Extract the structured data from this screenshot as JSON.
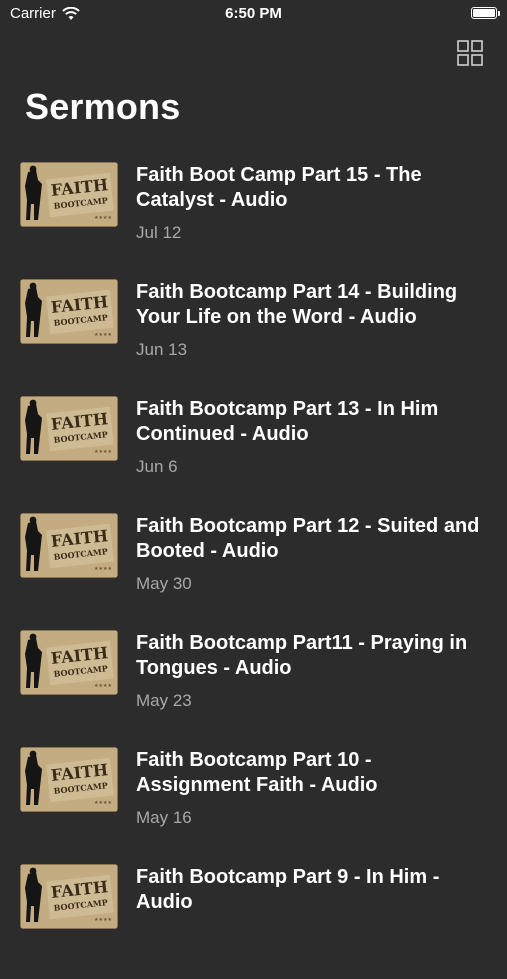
{
  "status_bar": {
    "carrier": "Carrier",
    "time": "6:50 PM"
  },
  "header": {
    "title": "Sermons",
    "grid_icon": "grid-view-icon"
  },
  "thumbnail": {
    "line1": "FAITH",
    "line2": "BOOTCAMP"
  },
  "sermons": [
    {
      "title": "Faith Boot Camp Part 15 - The Catalyst - Audio",
      "date": "Jul 12"
    },
    {
      "title": "Faith Bootcamp Part 14 - Building Your Life on the Word - Audio",
      "date": "Jun 13"
    },
    {
      "title": "Faith Bootcamp Part 13 - In Him Continued - Audio",
      "date": "Jun 6"
    },
    {
      "title": "Faith Bootcamp Part 12 - Suited and Booted - Audio",
      "date": "May 30"
    },
    {
      "title": "Faith Bootcamp Part11 - Praying in Tongues - Audio",
      "date": "May 23"
    },
    {
      "title": "Faith Bootcamp Part 10 - Assignment Faith - Audio",
      "date": "May 16"
    },
    {
      "title": "Faith Bootcamp Part 9 - In Him - Audio",
      "date": ""
    }
  ]
}
